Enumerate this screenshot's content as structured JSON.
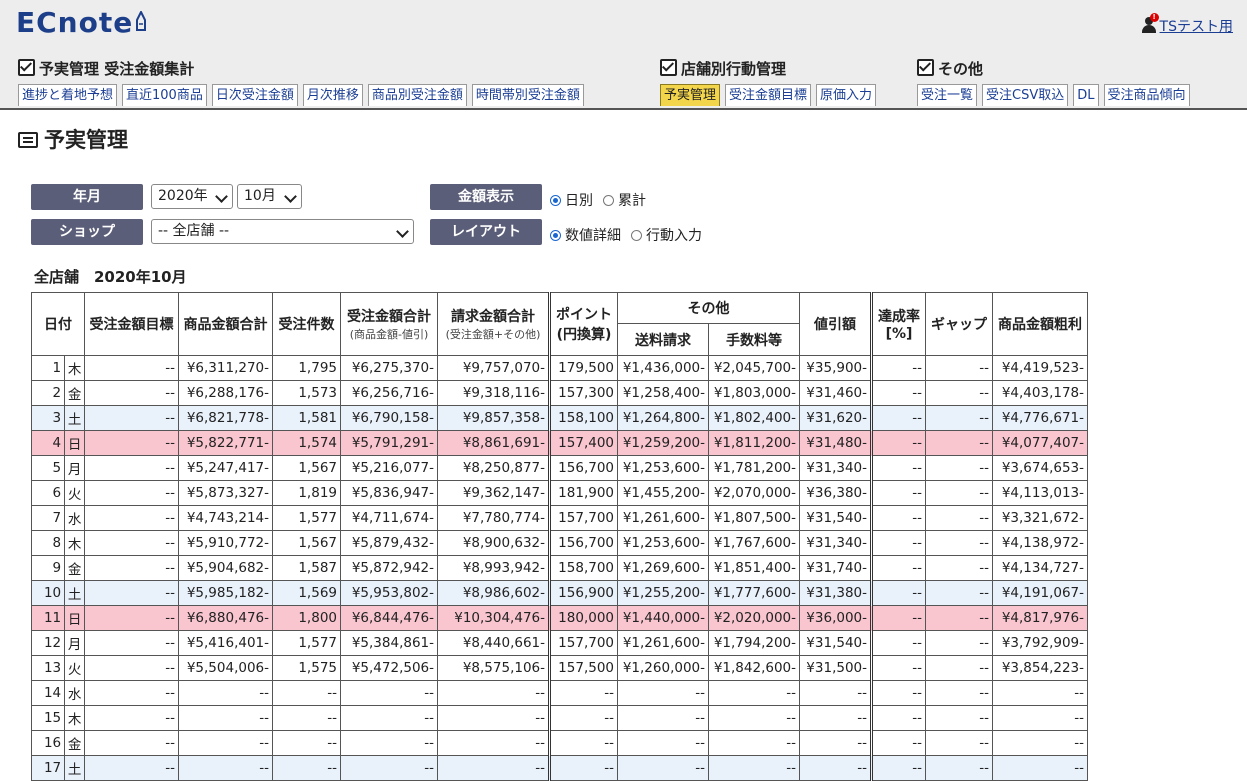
{
  "app": {
    "logo": "ECnote",
    "user_label": "TSテスト用",
    "notification_count": "!"
  },
  "nav": {
    "groups": [
      {
        "title": "予実管理 受注金額集計",
        "tabs": [
          "進捗と着地予想",
          "直近100商品",
          "日次受注金額",
          "月次推移",
          "商品別受注金額",
          "時間帯別受注金額"
        ]
      },
      {
        "title": "店舗別行動管理",
        "tabs": [
          "予実管理",
          "受注金額目標",
          "原価入力"
        ]
      },
      {
        "title": "その他",
        "tabs": [
          "受注一覧",
          "受注CSV取込",
          "DL",
          "受注商品傾向"
        ]
      }
    ],
    "active_tab": "予実管理"
  },
  "page_title": "予実管理",
  "filters": {
    "year_month_label": "年月",
    "year_value": "2020年",
    "month_value": "10月",
    "shop_label": "ショップ",
    "shop_value": "-- 全店舗 --",
    "amount_label": "金額表示",
    "amount_options": [
      "日別",
      "累計"
    ],
    "amount_selected": "日別",
    "layout_label": "レイアウト",
    "layout_options": [
      "数値詳細",
      "行動入力"
    ],
    "layout_selected": "数値詳細"
  },
  "caption": "全店舗　2020年10月",
  "table": {
    "headers": {
      "date": "日付",
      "target": "受注金額目標",
      "product_total": "商品金額合計",
      "count": "受注件数",
      "order_total": "受注金額合計",
      "order_total_sub": "(商品金額-値引)",
      "invoice_total": "請求金額合計",
      "invoice_total_sub": "(受注金額+その他)",
      "points": "ポイント",
      "points_sub": "(円換算)",
      "other": "その他",
      "shipping": "送料請求",
      "fees": "手数料等",
      "discount": "値引額",
      "rate": "達成率",
      "rate_sub": "[%]",
      "gap": "ギャップ",
      "gross": "商品金額粗利"
    },
    "rows": [
      {
        "d": "1",
        "w": "木",
        "k": "",
        "c": [
          "--",
          "¥6,311,270-",
          "1,795",
          "¥6,275,370-",
          "¥9,757,070-",
          "179,500",
          "¥1,436,000-",
          "¥2,045,700-",
          "¥35,900-",
          "--",
          "--",
          "¥4,419,523-"
        ]
      },
      {
        "d": "2",
        "w": "金",
        "k": "",
        "c": [
          "--",
          "¥6,288,176-",
          "1,573",
          "¥6,256,716-",
          "¥9,318,116-",
          "157,300",
          "¥1,258,400-",
          "¥1,803,000-",
          "¥31,460-",
          "--",
          "--",
          "¥4,403,178-"
        ]
      },
      {
        "d": "3",
        "w": "土",
        "k": "sat",
        "c": [
          "--",
          "¥6,821,778-",
          "1,581",
          "¥6,790,158-",
          "¥9,857,358-",
          "158,100",
          "¥1,264,800-",
          "¥1,802,400-",
          "¥31,620-",
          "--",
          "--",
          "¥4,776,671-"
        ]
      },
      {
        "d": "4",
        "w": "日",
        "k": "sun",
        "c": [
          "--",
          "¥5,822,771-",
          "1,574",
          "¥5,791,291-",
          "¥8,861,691-",
          "157,400",
          "¥1,259,200-",
          "¥1,811,200-",
          "¥31,480-",
          "--",
          "--",
          "¥4,077,407-"
        ]
      },
      {
        "d": "5",
        "w": "月",
        "k": "",
        "c": [
          "--",
          "¥5,247,417-",
          "1,567",
          "¥5,216,077-",
          "¥8,250,877-",
          "156,700",
          "¥1,253,600-",
          "¥1,781,200-",
          "¥31,340-",
          "--",
          "--",
          "¥3,674,653-"
        ]
      },
      {
        "d": "6",
        "w": "火",
        "k": "",
        "c": [
          "--",
          "¥5,873,327-",
          "1,819",
          "¥5,836,947-",
          "¥9,362,147-",
          "181,900",
          "¥1,455,200-",
          "¥2,070,000-",
          "¥36,380-",
          "--",
          "--",
          "¥4,113,013-"
        ]
      },
      {
        "d": "7",
        "w": "水",
        "k": "",
        "c": [
          "--",
          "¥4,743,214-",
          "1,577",
          "¥4,711,674-",
          "¥7,780,774-",
          "157,700",
          "¥1,261,600-",
          "¥1,807,500-",
          "¥31,540-",
          "--",
          "--",
          "¥3,321,672-"
        ]
      },
      {
        "d": "8",
        "w": "木",
        "k": "",
        "c": [
          "--",
          "¥5,910,772-",
          "1,567",
          "¥5,879,432-",
          "¥8,900,632-",
          "156,700",
          "¥1,253,600-",
          "¥1,767,600-",
          "¥31,340-",
          "--",
          "--",
          "¥4,138,972-"
        ]
      },
      {
        "d": "9",
        "w": "金",
        "k": "",
        "c": [
          "--",
          "¥5,904,682-",
          "1,587",
          "¥5,872,942-",
          "¥8,993,942-",
          "158,700",
          "¥1,269,600-",
          "¥1,851,400-",
          "¥31,740-",
          "--",
          "--",
          "¥4,134,727-"
        ]
      },
      {
        "d": "10",
        "w": "土",
        "k": "sat",
        "c": [
          "--",
          "¥5,985,182-",
          "1,569",
          "¥5,953,802-",
          "¥8,986,602-",
          "156,900",
          "¥1,255,200-",
          "¥1,777,600-",
          "¥31,380-",
          "--",
          "--",
          "¥4,191,067-"
        ]
      },
      {
        "d": "11",
        "w": "日",
        "k": "sun",
        "c": [
          "--",
          "¥6,880,476-",
          "1,800",
          "¥6,844,476-",
          "¥10,304,476-",
          "180,000",
          "¥1,440,000-",
          "¥2,020,000-",
          "¥36,000-",
          "--",
          "--",
          "¥4,817,976-"
        ]
      },
      {
        "d": "12",
        "w": "月",
        "k": "",
        "c": [
          "--",
          "¥5,416,401-",
          "1,577",
          "¥5,384,861-",
          "¥8,440,661-",
          "157,700",
          "¥1,261,600-",
          "¥1,794,200-",
          "¥31,540-",
          "--",
          "--",
          "¥3,792,909-"
        ]
      },
      {
        "d": "13",
        "w": "火",
        "k": "",
        "c": [
          "--",
          "¥5,504,006-",
          "1,575",
          "¥5,472,506-",
          "¥8,575,106-",
          "157,500",
          "¥1,260,000-",
          "¥1,842,600-",
          "¥31,500-",
          "--",
          "--",
          "¥3,854,223-"
        ]
      },
      {
        "d": "14",
        "w": "水",
        "k": "",
        "c": [
          "--",
          "--",
          "--",
          "--",
          "--",
          "--",
          "--",
          "--",
          "--",
          "--",
          "--",
          "--"
        ]
      },
      {
        "d": "15",
        "w": "木",
        "k": "",
        "c": [
          "--",
          "--",
          "--",
          "--",
          "--",
          "--",
          "--",
          "--",
          "--",
          "--",
          "--",
          "--"
        ]
      },
      {
        "d": "16",
        "w": "金",
        "k": "",
        "c": [
          "--",
          "--",
          "--",
          "--",
          "--",
          "--",
          "--",
          "--",
          "--",
          "--",
          "--",
          "--"
        ]
      },
      {
        "d": "17",
        "w": "土",
        "k": "sat",
        "c": [
          "--",
          "--",
          "--",
          "--",
          "--",
          "--",
          "--",
          "--",
          "--",
          "--",
          "--",
          "--"
        ]
      }
    ]
  },
  "colors": {
    "logo": "#1d3f8a",
    "active_tab": "#f3d54c",
    "label_bg": "#5b5e78",
    "sunday_row": "#f9c6d0",
    "saturday_row": "#e9f1fb",
    "link": "#1b3e94"
  }
}
